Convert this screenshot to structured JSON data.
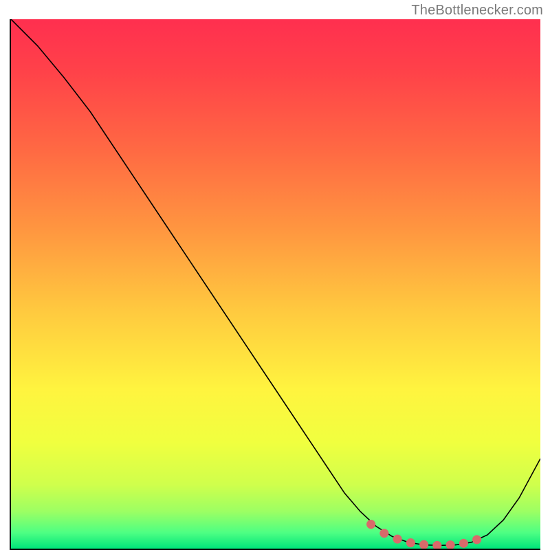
{
  "attribution": "TheBottlenecker.com",
  "chart_data": {
    "type": "line",
    "title": "",
    "xlabel": "",
    "ylabel": "",
    "xlim": [
      0,
      100
    ],
    "ylim": [
      0,
      100
    ],
    "gradient_stops": [
      {
        "offset": 0.0,
        "color": "#ff2f4f"
      },
      {
        "offset": 0.1,
        "color": "#ff4249"
      },
      {
        "offset": 0.25,
        "color": "#ff6a43"
      },
      {
        "offset": 0.4,
        "color": "#ff9740"
      },
      {
        "offset": 0.55,
        "color": "#ffc93f"
      },
      {
        "offset": 0.7,
        "color": "#fff43f"
      },
      {
        "offset": 0.8,
        "color": "#f0ff3f"
      },
      {
        "offset": 0.88,
        "color": "#cfff4c"
      },
      {
        "offset": 0.93,
        "color": "#9cff63"
      },
      {
        "offset": 0.97,
        "color": "#4dff83"
      },
      {
        "offset": 1.0,
        "color": "#00e47a"
      }
    ],
    "main_curve": {
      "name": "bottleneck-curve",
      "x": [
        0,
        5,
        10,
        15,
        20,
        25,
        30,
        35,
        40,
        45,
        50,
        55,
        60,
        63,
        66,
        69,
        72,
        75,
        78,
        81,
        84,
        87,
        90,
        93,
        96,
        100
      ],
      "y": [
        100,
        95,
        89,
        82.5,
        75,
        67.5,
        60,
        52.5,
        45,
        37.5,
        30,
        22.5,
        15,
        10.5,
        7,
        4.2,
        2.3,
        1.2,
        0.7,
        0.6,
        0.7,
        1.2,
        2.6,
        5.4,
        9.6,
        17
      ]
    },
    "valley_markers": {
      "name": "optimal-range",
      "color": "#d96a6a",
      "points": [
        {
          "x": 68,
          "y": 4.6
        },
        {
          "x": 70.5,
          "y": 2.9
        },
        {
          "x": 73,
          "y": 1.8
        },
        {
          "x": 75.5,
          "y": 1.1
        },
        {
          "x": 78,
          "y": 0.75
        },
        {
          "x": 80.5,
          "y": 0.6
        },
        {
          "x": 83,
          "y": 0.7
        },
        {
          "x": 85.5,
          "y": 1.0
        },
        {
          "x": 88,
          "y": 1.7
        }
      ]
    }
  }
}
